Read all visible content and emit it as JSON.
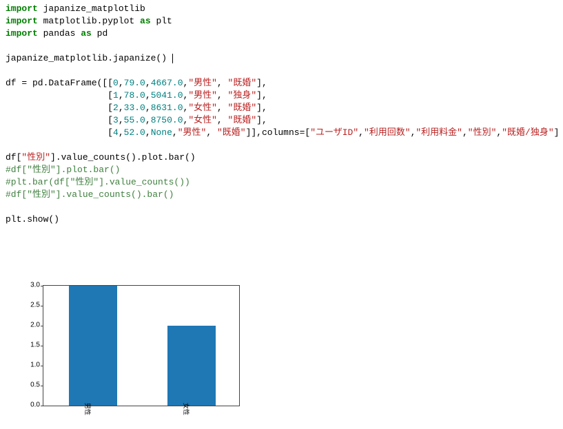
{
  "code": {
    "line01_import": "import",
    "line01_mod": " japanize_matplotlib",
    "line02_import": "import",
    "line02_mod": " matplotlib.pyplot ",
    "line02_as": "as",
    "line02_alias": " plt",
    "line03_import": "import",
    "line03_mod": " pandas ",
    "line03_as": "as",
    "line03_alias": " pd",
    "line05": "japanize_matplotlib.japanize() ",
    "line07_a": "df = pd.DataFrame([[",
    "n_0": "0",
    "n_79": "79.0",
    "n_4667": "4667.0",
    "s_male": "\"男性\"",
    "s_married": "\"既婚\"",
    "n_1": "1",
    "n_78": "78.0",
    "n_5041": "5041.0",
    "s_single": "\"独身\"",
    "n_2": "2",
    "n_33": "33.0",
    "n_8631": "8631.0",
    "s_female": "\"女性\"",
    "n_3": "3",
    "n_55": "55.0",
    "n_8750": "8750.0",
    "n_4": "4",
    "n_52": "52.0",
    "none": "None",
    "col_open": "]],columns=[",
    "c1": "\"ユーザID\"",
    "c2": "\"利用回数\"",
    "c3": "\"利用料金\"",
    "c4": "\"性別\"",
    "c5": "\"既婚/独身\"",
    "col_close": "])",
    "line09a": "df[",
    "line09b": "\"性別\"",
    "line09c": "].value_counts().plot.bar()",
    "cmt1": "#df[\"性別\"].plot.bar()",
    "cmt2": "#plt.bar(df[\"性別\"].value_counts())",
    "cmt3": "#df[\"性別\"].value_counts().bar()",
    "line14": "plt.show()",
    "comma": ",",
    "space": " ",
    "close": "],",
    "indent": "                   ["
  },
  "chart_data": {
    "type": "bar",
    "categories": [
      "男性",
      "女性"
    ],
    "values": [
      3,
      2
    ],
    "ylim": [
      0,
      3
    ],
    "yticks": [
      0.0,
      0.5,
      1.0,
      1.5,
      2.0,
      2.5,
      3.0
    ],
    "ytick_labels": [
      "0.0",
      "0.5",
      "1.0",
      "1.5",
      "2.0",
      "2.5",
      "3.0"
    ]
  }
}
